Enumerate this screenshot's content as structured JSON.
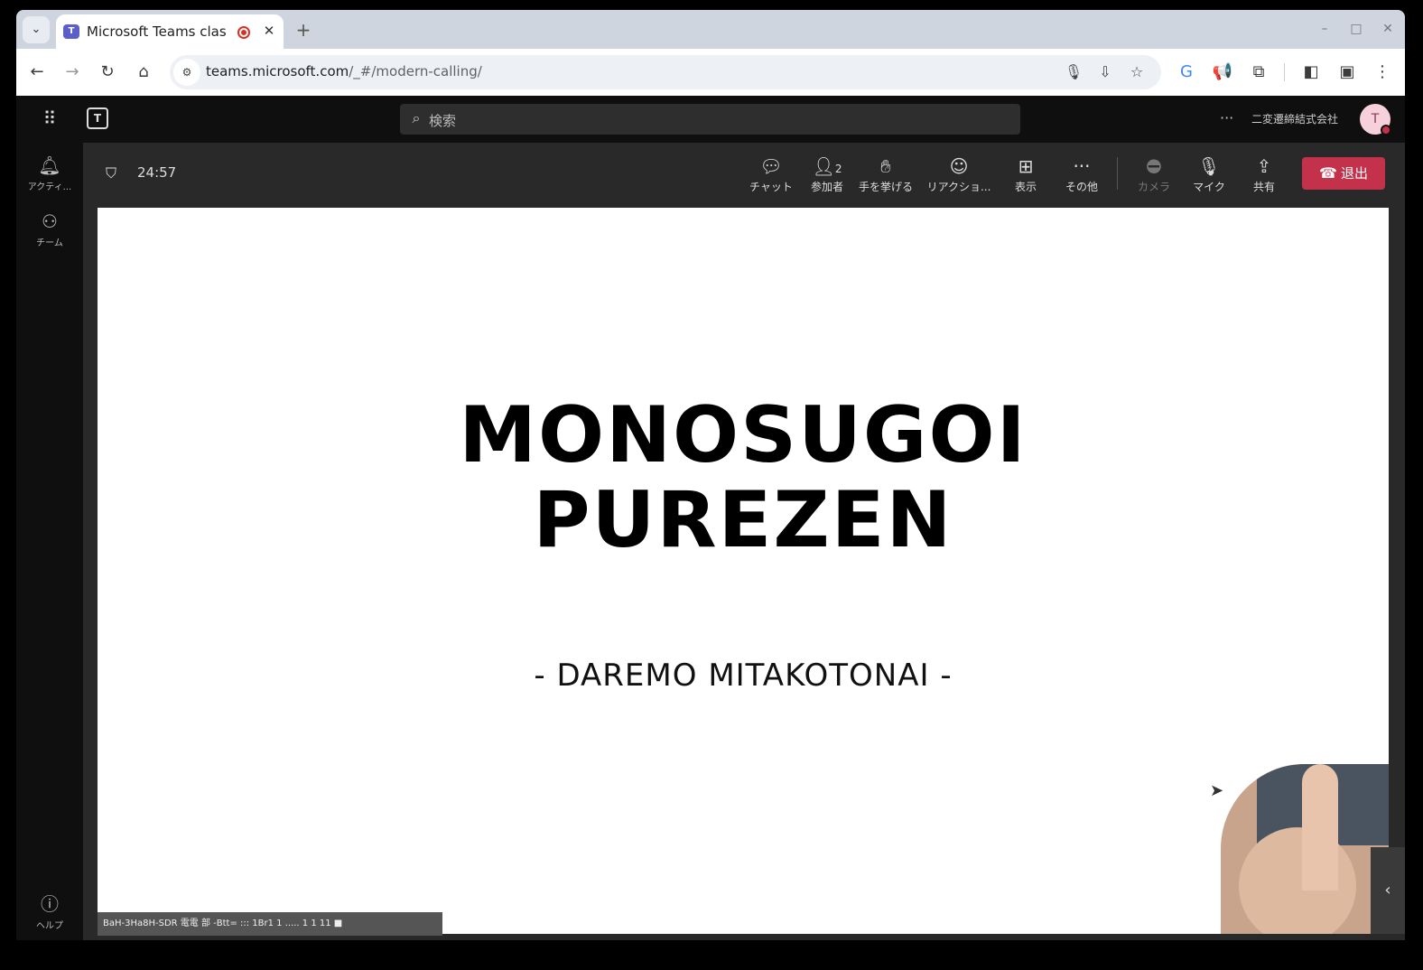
{
  "browser": {
    "tab_title": "Microsoft Teams clas",
    "tab_close": "✕",
    "new_tab": "+",
    "tab_search": "⌄",
    "url_host": "teams.microsoft.com",
    "url_path": "/_#/modern-calling/",
    "window_controls": [
      "–",
      "□",
      "✕"
    ]
  },
  "teams": {
    "search_placeholder": "検索",
    "more": "···",
    "org_name": "二変遷締結式会社",
    "avatar_initial": "T",
    "rail": {
      "activity": "アクティ...",
      "teams": "チーム",
      "help": "ヘルプ"
    }
  },
  "meeting": {
    "timer": "24:57",
    "participants_count": "2",
    "controls": {
      "chat": "チャット",
      "participants": "参加者",
      "raise_hand": "手を挙げる",
      "reactions": "リアクショ...",
      "view": "表示",
      "more": "その他",
      "camera": "カメラ",
      "mic": "マイク",
      "share": "共有",
      "leave": "退出"
    },
    "accent_color": "#c4314b",
    "caption": "BaH-3Ha8H-SDR 電電 部 -Btt= ::: 1Br1 1 ..... 1 1 11 ■"
  },
  "slide": {
    "title_line1": "MONOSUGOI",
    "title_line2": "PUREZEN",
    "subtitle": "- DAREMO MITAKOTONAI -"
  }
}
